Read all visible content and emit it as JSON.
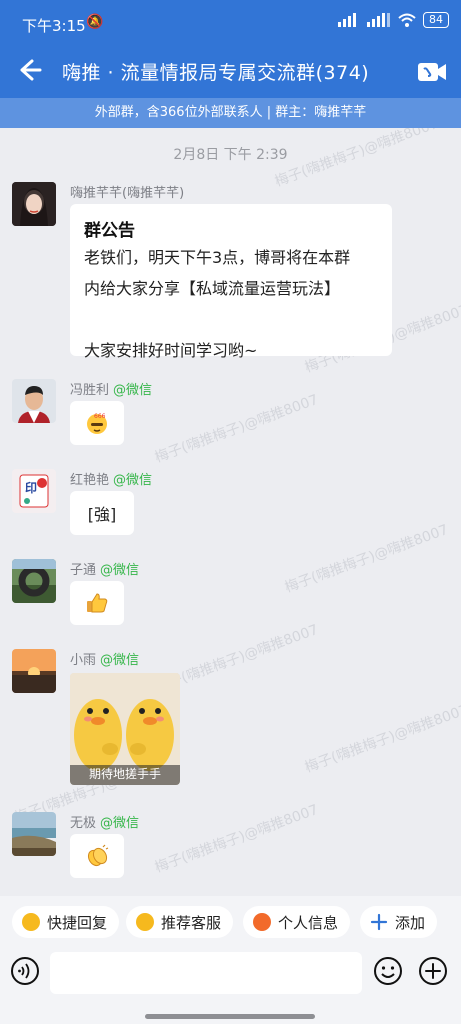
{
  "status_bar": {
    "time": "下午3:15",
    "battery": "84"
  },
  "header": {
    "title": "嗨推 · 流量情报局专属交流群(374)"
  },
  "group_info": "外部群，含366位外部联系人 | 群主：嗨推芊芊",
  "timestamp": "2月8日  下午 2:39",
  "watermark": "梅子(嗨推梅子)@嗨推8007",
  "messages": [
    {
      "sender": "嗨推芊芊(嗨推芊芊)",
      "tag": "",
      "notice_title": "群公告",
      "notice_text": "老铁们，明天下午3点，博哥将在本群\n内给大家分享【私域流量运营玩法】\n\n大家安排好时间学习哟~"
    },
    {
      "sender": "冯胜利",
      "tag": "@微信",
      "content": ""
    },
    {
      "sender": "红艳艳",
      "tag": "@微信",
      "content": "[強]"
    },
    {
      "sender": "子通",
      "tag": "@微信",
      "content": ""
    },
    {
      "sender": "小雨",
      "tag": "@微信",
      "sticker_caption": "期待地搓手手"
    },
    {
      "sender": "无极",
      "tag": "@微信",
      "content": ""
    }
  ],
  "quick_actions": [
    "快捷回复",
    "推荐客服",
    "个人信息",
    "添加"
  ],
  "colors": {
    "primary": "#3275D6",
    "subbar": "#5E93E0",
    "tag_green": "#36B64A",
    "background": "#ECEDF1"
  }
}
